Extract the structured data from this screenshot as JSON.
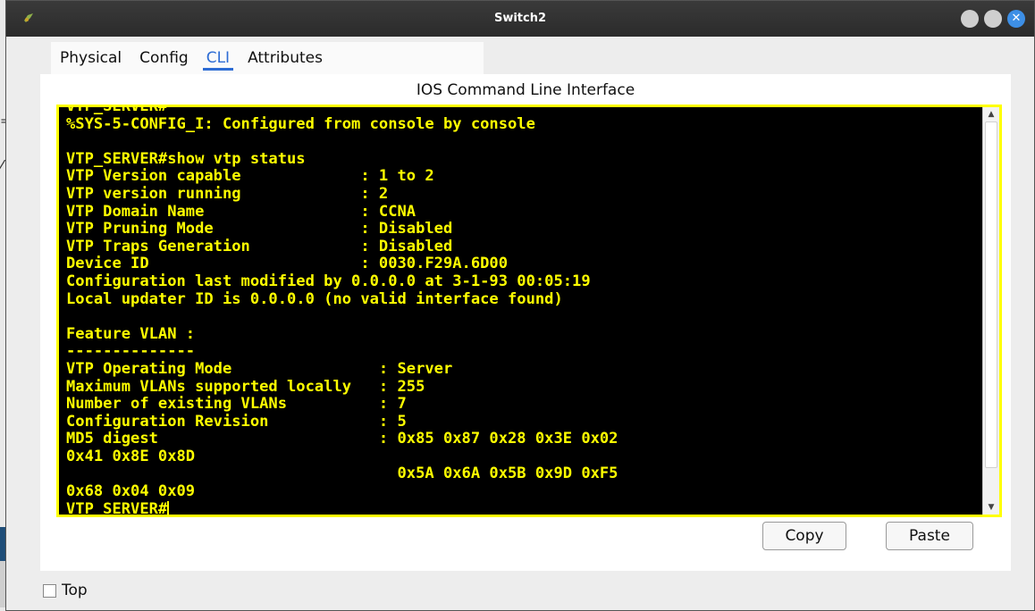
{
  "window": {
    "title": "Switch2"
  },
  "tabs": [
    {
      "label": "Physical"
    },
    {
      "label": "Config"
    },
    {
      "label": "CLI"
    },
    {
      "label": "Attributes"
    }
  ],
  "panel": {
    "title": "IOS Command Line Interface"
  },
  "terminal": {
    "lines": [
      "VTP_SERVER#",
      "%SYS-5-CONFIG_I: Configured from console by console",
      "",
      "VTP_SERVER#show vtp status",
      "VTP Version capable             : 1 to 2",
      "VTP version running             : 2",
      "VTP Domain Name                 : CCNA",
      "VTP Pruning Mode                : Disabled",
      "VTP Traps Generation            : Disabled",
      "Device ID                       : 0030.F29A.6D00",
      "Configuration last modified by 0.0.0.0 at 3-1-93 00:05:19",
      "Local updater ID is 0.0.0.0 (no valid interface found)",
      "",
      "Feature VLAN :",
      "--------------",
      "VTP Operating Mode                : Server",
      "Maximum VLANs supported locally   : 255",
      "Number of existing VLANs          : 7",
      "Configuration Revision            : 5",
      "MD5 digest                        : 0x85 0x87 0x28 0x3E 0x02",
      "0x41 0x8E 0x8D",
      "                                    0x5A 0x6A 0x5B 0x9D 0xF5",
      "0x68 0x04 0x09"
    ],
    "prompt": "VTP_SERVER#"
  },
  "buttons": {
    "copy": "Copy",
    "paste": "Paste"
  },
  "footer": {
    "top_label": "Top"
  },
  "background": {
    "frag1": "=:",
    "frag2": "⁄"
  },
  "colors": {
    "terminal_text": "#ffff00",
    "terminal_bg": "#000000",
    "accent": "#2d6cd4"
  }
}
